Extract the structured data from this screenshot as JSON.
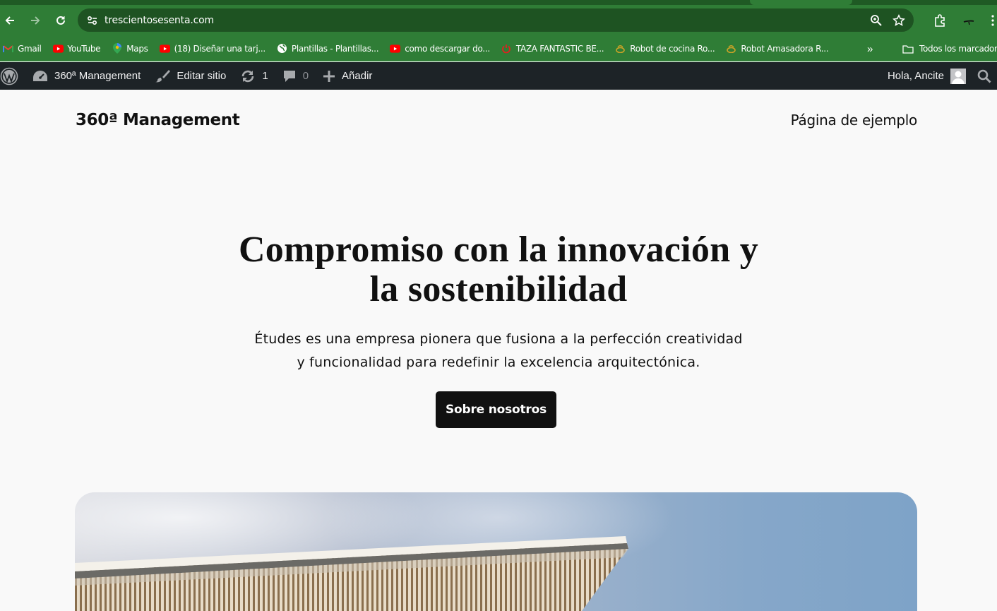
{
  "browser": {
    "url": "trescientosesenta.com",
    "bookmarks": [
      {
        "label": "Gmail",
        "icon": "gmail-icon"
      },
      {
        "label": "YouTube",
        "icon": "youtube-icon"
      },
      {
        "label": "Maps",
        "icon": "maps-icon"
      },
      {
        "label": "(18) Diseñar una tarj...",
        "icon": "youtube-icon"
      },
      {
        "label": "Plantillas - Plantillas...",
        "icon": "globe-icon"
      },
      {
        "label": "como descargar do...",
        "icon": "youtube-icon"
      },
      {
        "label": "TAZA FANTASTIC BE...",
        "icon": "power-icon"
      },
      {
        "label": "Robot de cocina Ro...",
        "icon": "robot-icon"
      },
      {
        "label": "Robot Amasadora R...",
        "icon": "robot-icon"
      }
    ],
    "overflow_label": "»",
    "all_bookmarks_label": "Todos los marcadores",
    "theme_color": "#2f7d36"
  },
  "adminbar": {
    "site_name": "360ª Management",
    "edit_site": "Editar sitio",
    "updates_count": "1",
    "comments_count": "0",
    "add_new": "Añadir",
    "greeting": "Hola, Ancite"
  },
  "site": {
    "title": "360ª Management",
    "nav_link": "Página de ejemplo"
  },
  "hero": {
    "title_line1": "Compromiso con la innovación y",
    "title_line2": "la sostenibilidad",
    "text_line1": "Études es una empresa pionera que fusiona a la perfección creatividad",
    "text_line2": "y funcionalidad para redefinir la excelencia arquitectónica.",
    "button_label": "Sobre nosotros"
  }
}
